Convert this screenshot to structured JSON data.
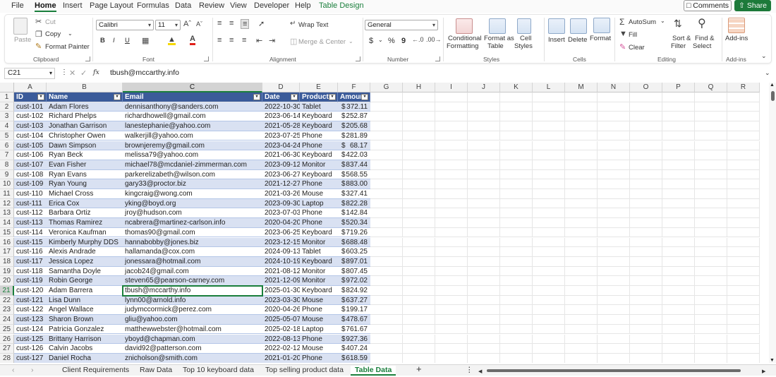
{
  "menu": {
    "items": [
      "File",
      "Home",
      "Insert",
      "Page Layout",
      "Formulas",
      "Data",
      "Review",
      "View",
      "Developer",
      "Help",
      "Table Design"
    ],
    "active": "Home",
    "comments_label": "Comments",
    "share_label": "Share"
  },
  "ribbon": {
    "clipboard": {
      "paste": "Paste",
      "cut": "Cut",
      "copy": "Copy",
      "format_painter": "Format Painter",
      "label": "Clipboard"
    },
    "font": {
      "name": "Calibri",
      "size": "11",
      "bold": "B",
      "italic": "I",
      "underline": "U",
      "label": "Font"
    },
    "alignment": {
      "wrap_text": "Wrap Text",
      "merge_center": "Merge & Center",
      "label": "Alignment"
    },
    "number": {
      "format": "General",
      "currency": "$",
      "percent": "%",
      "comma": "9",
      "label": "Number"
    },
    "styles": {
      "conditional": "Conditional",
      "conditional2": "Formatting",
      "format_as": "Format as",
      "format_as2": "Table",
      "cell": "Cell",
      "cell2": "Styles",
      "label": "Styles"
    },
    "cells": {
      "insert": "Insert",
      "delete": "Delete",
      "format": "Format",
      "label": "Cells"
    },
    "editing": {
      "autosum": "AutoSum",
      "fill": "Fill",
      "clear": "Clear",
      "sort": "Sort &",
      "sort2": "Filter",
      "find": "Find &",
      "find2": "Select",
      "label": "Editing"
    },
    "addins": {
      "addins": "Add-ins",
      "label": "Add-ins"
    }
  },
  "formula_bar": {
    "name_box": "C21",
    "fx": "fx",
    "value": "tbush@mccarthy.info"
  },
  "columns": [
    "A",
    "B",
    "C",
    "D",
    "E",
    "F",
    "G",
    "H",
    "I",
    "J",
    "K",
    "L",
    "M",
    "N",
    "O",
    "P",
    "Q",
    "R"
  ],
  "table": {
    "headers": [
      "ID",
      "Name",
      "Email",
      "Date",
      "Product",
      "Amount"
    ],
    "rows": [
      [
        "cust-101",
        "Adam Flores",
        "dennisanthony@sanders.com",
        "2022-10-30",
        "Tablet",
        "372.11"
      ],
      [
        "cust-102",
        "Richard Phelps",
        "richardhowell@gmail.com",
        "2023-06-14",
        "Keyboard",
        "252.87"
      ],
      [
        "cust-103",
        "Jonathan Garrison",
        "lanestephanie@yahoo.com",
        "2021-05-28",
        "Keyboard",
        "205.68"
      ],
      [
        "cust-104",
        "Christopher Owen",
        "walkerjill@yahoo.com",
        "2023-07-25",
        "Phone",
        "281.89"
      ],
      [
        "cust-105",
        "Dawn Simpson",
        "brownjeremy@gmail.com",
        "2023-04-24",
        "Phone",
        "68.17"
      ],
      [
        "cust-106",
        "Ryan Beck",
        "melissa79@yahoo.com",
        "2021-06-30",
        "Keyboard",
        "422.03"
      ],
      [
        "cust-107",
        "Evan Fisher",
        "michael78@mcdaniel-zimmerman.com",
        "2023-09-12",
        "Monitor",
        "837.44"
      ],
      [
        "cust-108",
        "Ryan Evans",
        "parkerelizabeth@wilson.com",
        "2023-06-27",
        "Keyboard",
        "568.55"
      ],
      [
        "cust-109",
        "Ryan Young",
        "gary33@proctor.biz",
        "2021-12-27",
        "Phone",
        "883.00"
      ],
      [
        "cust-110",
        "Michael Cross",
        "kingcraig@wong.com",
        "2021-03-26",
        "Mouse",
        "327.41"
      ],
      [
        "cust-111",
        "Erica Cox",
        "yking@boyd.org",
        "2023-09-30",
        "Laptop",
        "822.28"
      ],
      [
        "cust-112",
        "Barbara Ortiz",
        "jroy@hudson.com",
        "2023-07-03",
        "Phone",
        "142.84"
      ],
      [
        "cust-113",
        "Thomas Ramirez",
        "ncabrera@martinez-carlson.info",
        "2020-04-20",
        "Phone",
        "520.34"
      ],
      [
        "cust-114",
        "Veronica Kaufman",
        "thomas90@gmail.com",
        "2023-06-25",
        "Keyboard",
        "719.26"
      ],
      [
        "cust-115",
        "Kimberly Murphy DDS",
        "hannabobby@jones.biz",
        "2023-12-15",
        "Monitor",
        "688.48"
      ],
      [
        "cust-116",
        "Alexis Andrade",
        "hallamanda@cox.com",
        "2024-09-13",
        "Tablet",
        "603.25"
      ],
      [
        "cust-117",
        "Jessica Lopez",
        "jonessara@hotmail.com",
        "2024-10-19",
        "Keyboard",
        "897.01"
      ],
      [
        "cust-118",
        "Samantha Doyle",
        "jacob24@gmail.com",
        "2021-08-12",
        "Monitor",
        "807.45"
      ],
      [
        "cust-119",
        "Robin George",
        "steven65@pearson-carney.com",
        "2021-12-09",
        "Monitor",
        "972.02"
      ],
      [
        "cust-120",
        "Adam Barrera",
        "tbush@mccarthy.info",
        "2025-01-30",
        "Keyboard",
        "824.92"
      ],
      [
        "cust-121",
        "Lisa Dunn",
        "lynn00@arnold.info",
        "2023-03-30",
        "Mouse",
        "637.27"
      ],
      [
        "cust-122",
        "Angel Wallace",
        "judymccormick@perez.com",
        "2020-04-26",
        "Phone",
        "199.17"
      ],
      [
        "cust-123",
        "Sharon Brown",
        "gliu@yahoo.com",
        "2025-05-07",
        "Mouse",
        "478.67"
      ],
      [
        "cust-124",
        "Patricia Gonzalez",
        "matthewwebster@hotmail.com",
        "2025-02-18",
        "Laptop",
        "761.67"
      ],
      [
        "cust-125",
        "Brittany Harrison",
        "yboyd@chapman.com",
        "2022-08-13",
        "Phone",
        "927.36"
      ],
      [
        "cust-126",
        "Calvin Jacobs",
        "david92@patterson.com",
        "2022-02-12",
        "Mouse",
        "407.24"
      ],
      [
        "cust-127",
        "Daniel Rocha",
        "znicholson@smith.com",
        "2021-01-20",
        "Phone",
        "618.59"
      ]
    ],
    "currency_symbol": "$",
    "active_row": 21,
    "active_col": "C"
  },
  "sheets": {
    "tabs": [
      "Client Requirements",
      "Raw Data",
      "Top 10 keyboard data",
      "Top selling product data",
      "Table Data"
    ],
    "active": "Table Data",
    "add_label": "+"
  },
  "colors": {
    "accent": "#1a7f3c",
    "table_header": "#3b5b9a",
    "band": "#d9e1f2"
  }
}
